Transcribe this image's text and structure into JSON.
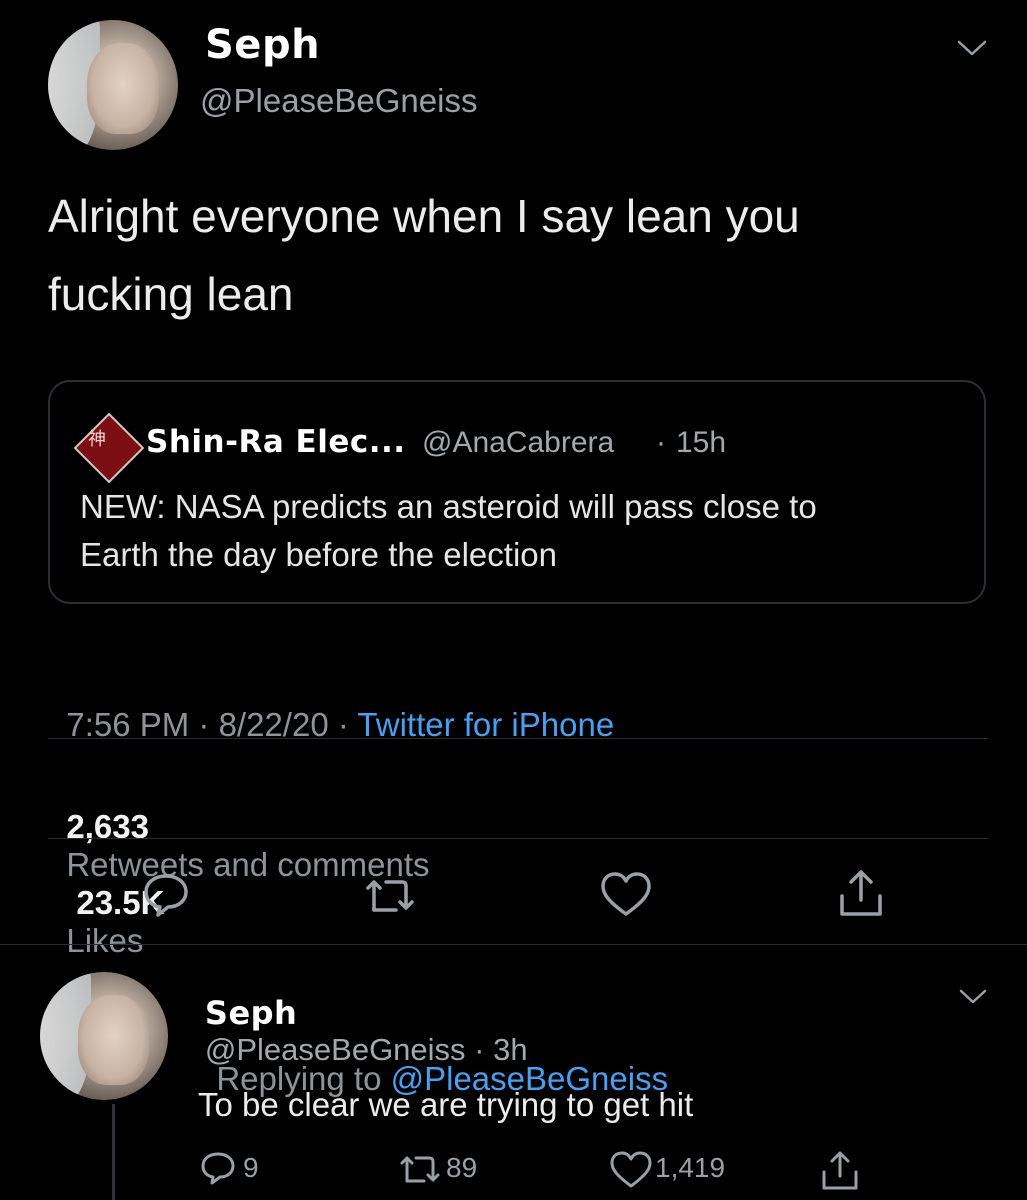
{
  "tweet": {
    "display_name": "Seph",
    "handle": "@PleaseBeGneiss",
    "text_line1": "Alright everyone when I say lean you",
    "text_line2": "fucking lean",
    "quote": {
      "name": "Shin-Ra Elec...",
      "handle": "@AnaCabrera",
      "sep": "·",
      "age": "15h",
      "text_line1": "NEW: NASA predicts an asteroid will pass close to",
      "text_line2": "Earth the day before the election"
    },
    "timestamp": "7:56 PM · 8/22/20 · ",
    "source": "Twitter for iPhone",
    "retweets_count": "2,633",
    "retweets_label": "Retweets and comments",
    "likes_count": "23.5K",
    "likes_label": "Likes"
  },
  "reply": {
    "display_name": "Seph",
    "handle": "@PleaseBeGneiss · 3h",
    "replying_prefix": "Replying to ",
    "replying_handle": "@PleaseBeGneiss",
    "text": "To be clear we are trying to get hit",
    "reply_count": "9",
    "retweet_count": "89",
    "like_count": "1,419"
  },
  "icons": {
    "chevron": "chevron-down-icon",
    "reply": "comment-icon",
    "retweet": "retweet-icon",
    "like": "heart-icon",
    "share": "share-icon"
  },
  "colors": {
    "background": "#000000",
    "link": "#4a9ff0",
    "muted": "#8a8f94",
    "text": "#f2f2f2"
  }
}
